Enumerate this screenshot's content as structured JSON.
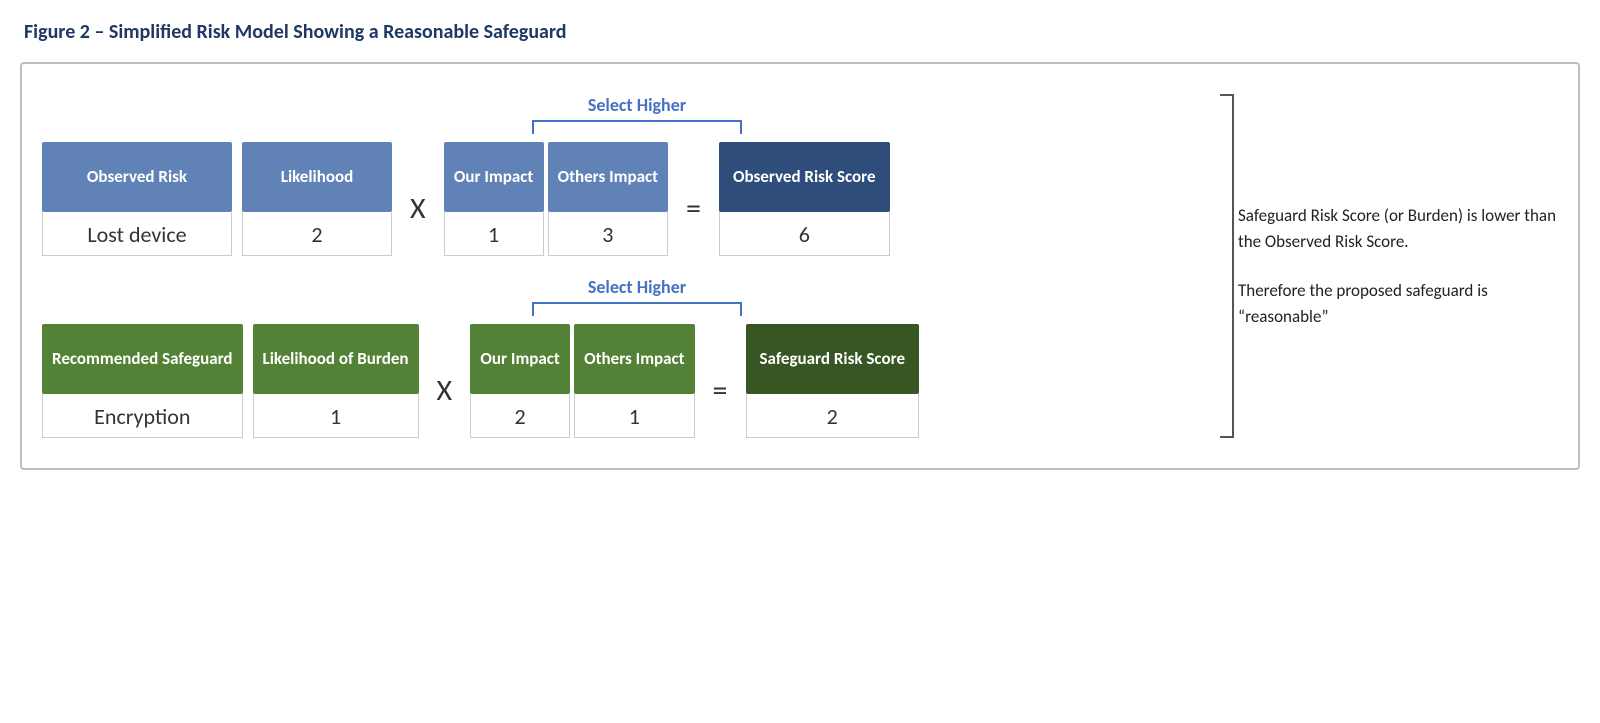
{
  "figure": {
    "title": "Figure 2 – Simplified Risk Model Showing a Reasonable Safeguard"
  },
  "selectHigher": "Select Higher",
  "xSymbol": "X",
  "equalsSymbol": "=",
  "topRow": {
    "observedRisk": {
      "header": "Observed Risk",
      "value": "Lost device"
    },
    "likelihood": {
      "header": "Likelihood",
      "value": "2"
    },
    "ourImpact": {
      "header": "Our Impact",
      "value": "1"
    },
    "othersImpact": {
      "header": "Others Impact",
      "value": "3"
    },
    "result": {
      "header": "Observed Risk Score",
      "value": "6"
    }
  },
  "bottomRow": {
    "recommendedSafeguard": {
      "header": "Recommended Safeguard",
      "value": "Encryption"
    },
    "likelihood": {
      "header": "Likelihood of Burden",
      "value": "1"
    },
    "ourImpact": {
      "header": "Our Impact",
      "value": "2"
    },
    "othersImpact": {
      "header": "Others Impact",
      "value": "1"
    },
    "result": {
      "header": "Safeguard Risk Score",
      "value": "2"
    }
  },
  "rightText": {
    "paragraph1": "Safeguard Risk Score (or Burden) is lower than the Observed Risk Score.",
    "paragraph2": "Therefore the proposed safeguard is “reasonable”"
  }
}
